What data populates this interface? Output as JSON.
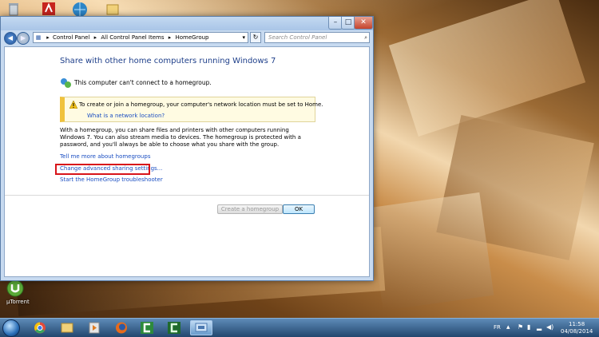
{
  "desktop": {
    "icons": [
      {
        "name": "utorrent",
        "label": "µTorrent"
      }
    ]
  },
  "window": {
    "address_segments": [
      "Control Panel",
      "All Control Panel Items",
      "HomeGroup"
    ],
    "address_separator": "▸",
    "search_placeholder": "Search Control Panel",
    "title": "Share with other home computers running Windows 7",
    "status": "This computer can't connect to a homegroup.",
    "warning_text": "To create or join a homegroup, your computer's network location must be set to Home.",
    "warning_link": "What is a network location?",
    "description": "With a homegroup, you can share files and printers with other computers running Windows 7. You can also stream media to devices. The homegroup is protected with a password, and you'll always be able to choose what you share with the group.",
    "links": [
      "Tell me more about homegroups",
      "Change advanced sharing settings...",
      "Start the HomeGroup troubleshooter"
    ],
    "buttons": {
      "create": "Create a homegroup",
      "ok": "OK"
    },
    "window_buttons": {
      "minimize": "–",
      "maximize": "□",
      "close": "✕"
    }
  },
  "taskbar": {
    "language": "FR",
    "time": "11:58",
    "date": "04/08/2014"
  },
  "colors": {
    "link": "#1a4ec2",
    "title": "#1e3f8a",
    "highlight": "#d8141a",
    "warning": "#f0c23c"
  }
}
